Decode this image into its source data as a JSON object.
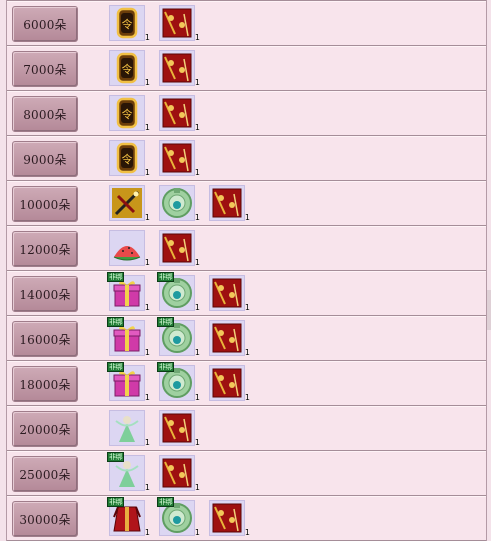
{
  "rows": [
    {
      "label": "6000朵",
      "items": [
        {
          "icon": "gold-token",
          "qty": "1"
        },
        {
          "icon": "red-envelope",
          "qty": "1"
        }
      ]
    },
    {
      "label": "7000朵",
      "items": [
        {
          "icon": "gold-token",
          "qty": "1"
        },
        {
          "icon": "red-envelope",
          "qty": "1"
        }
      ]
    },
    {
      "label": "8000朵",
      "items": [
        {
          "icon": "gold-token",
          "qty": "1"
        },
        {
          "icon": "red-envelope",
          "qty": "1"
        }
      ]
    },
    {
      "label": "9000朵",
      "items": [
        {
          "icon": "gold-token",
          "qty": "1"
        },
        {
          "icon": "red-envelope",
          "qty": "1"
        }
      ]
    },
    {
      "label": "10000朵",
      "items": [
        {
          "icon": "sword-scroll",
          "qty": "1"
        },
        {
          "icon": "jade-medal",
          "qty": "1"
        },
        {
          "icon": "red-envelope",
          "qty": "1"
        }
      ]
    },
    {
      "label": "12000朵",
      "items": [
        {
          "icon": "watermelon",
          "qty": "1"
        },
        {
          "icon": "red-envelope",
          "qty": "1"
        }
      ]
    },
    {
      "label": "14000朵",
      "items": [
        {
          "icon": "gift-box",
          "qty": "1",
          "tag": "非绑"
        },
        {
          "icon": "jade-medal",
          "qty": "1",
          "tag": "非绑"
        },
        {
          "icon": "red-envelope",
          "qty": "1"
        }
      ]
    },
    {
      "label": "16000朵",
      "items": [
        {
          "icon": "gift-box",
          "qty": "1",
          "tag": "非绑"
        },
        {
          "icon": "jade-medal",
          "qty": "1",
          "tag": "非绑"
        },
        {
          "icon": "red-envelope",
          "qty": "1"
        }
      ]
    },
    {
      "label": "18000朵",
      "items": [
        {
          "icon": "gift-box",
          "qty": "1",
          "tag": "非绑"
        },
        {
          "icon": "jade-medal",
          "qty": "1",
          "tag": "非绑"
        },
        {
          "icon": "red-envelope",
          "qty": "1"
        }
      ]
    },
    {
      "label": "20000朵",
      "items": [
        {
          "icon": "fairy-figure",
          "qty": "1"
        },
        {
          "icon": "red-envelope",
          "qty": "1"
        }
      ]
    },
    {
      "label": "25000朵",
      "items": [
        {
          "icon": "fairy-figure",
          "qty": "1",
          "tag": "非绑"
        },
        {
          "icon": "red-envelope",
          "qty": "1"
        }
      ]
    },
    {
      "label": "30000朵",
      "items": [
        {
          "icon": "red-robe",
          "qty": "1",
          "tag": "非绑"
        },
        {
          "icon": "jade-medal",
          "qty": "1",
          "tag": "非绑"
        },
        {
          "icon": "red-envelope",
          "qty": "1"
        }
      ]
    }
  ]
}
